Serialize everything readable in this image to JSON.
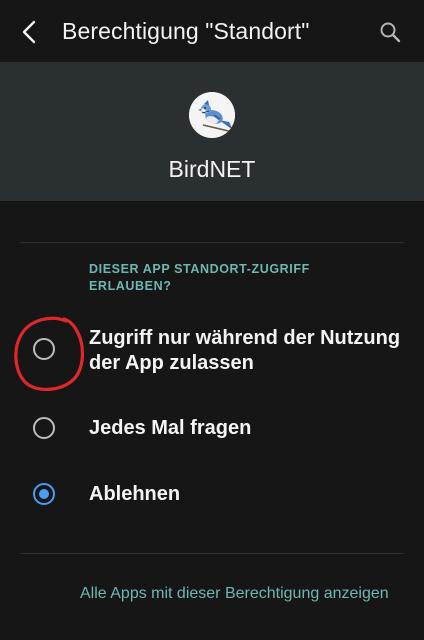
{
  "header": {
    "back_icon": "back-arrow-icon",
    "title": "Berechtigung \"Standort\"",
    "search_icon": "search-icon"
  },
  "app": {
    "icon": "blue-jay-bird-icon",
    "name": "BirdNET"
  },
  "permission": {
    "section_title": "DIESER APP STANDORT-ZUGRIFF ERLAUBEN?",
    "options": [
      {
        "label": "Zugriff nur während der Nutzung der App zulassen",
        "selected": false
      },
      {
        "label": "Jedes Mal fragen",
        "selected": false
      },
      {
        "label": "Ablehnen",
        "selected": true
      }
    ],
    "footer_link": "Alle Apps mit dieser Berechtigung anzeigen"
  },
  "colors": {
    "background": "#161616",
    "app_header": "#2a2f32",
    "accent_teal": "#6fb7b1",
    "radio_selected": "#4c9cf3",
    "annotation_red": "#e0282a"
  }
}
